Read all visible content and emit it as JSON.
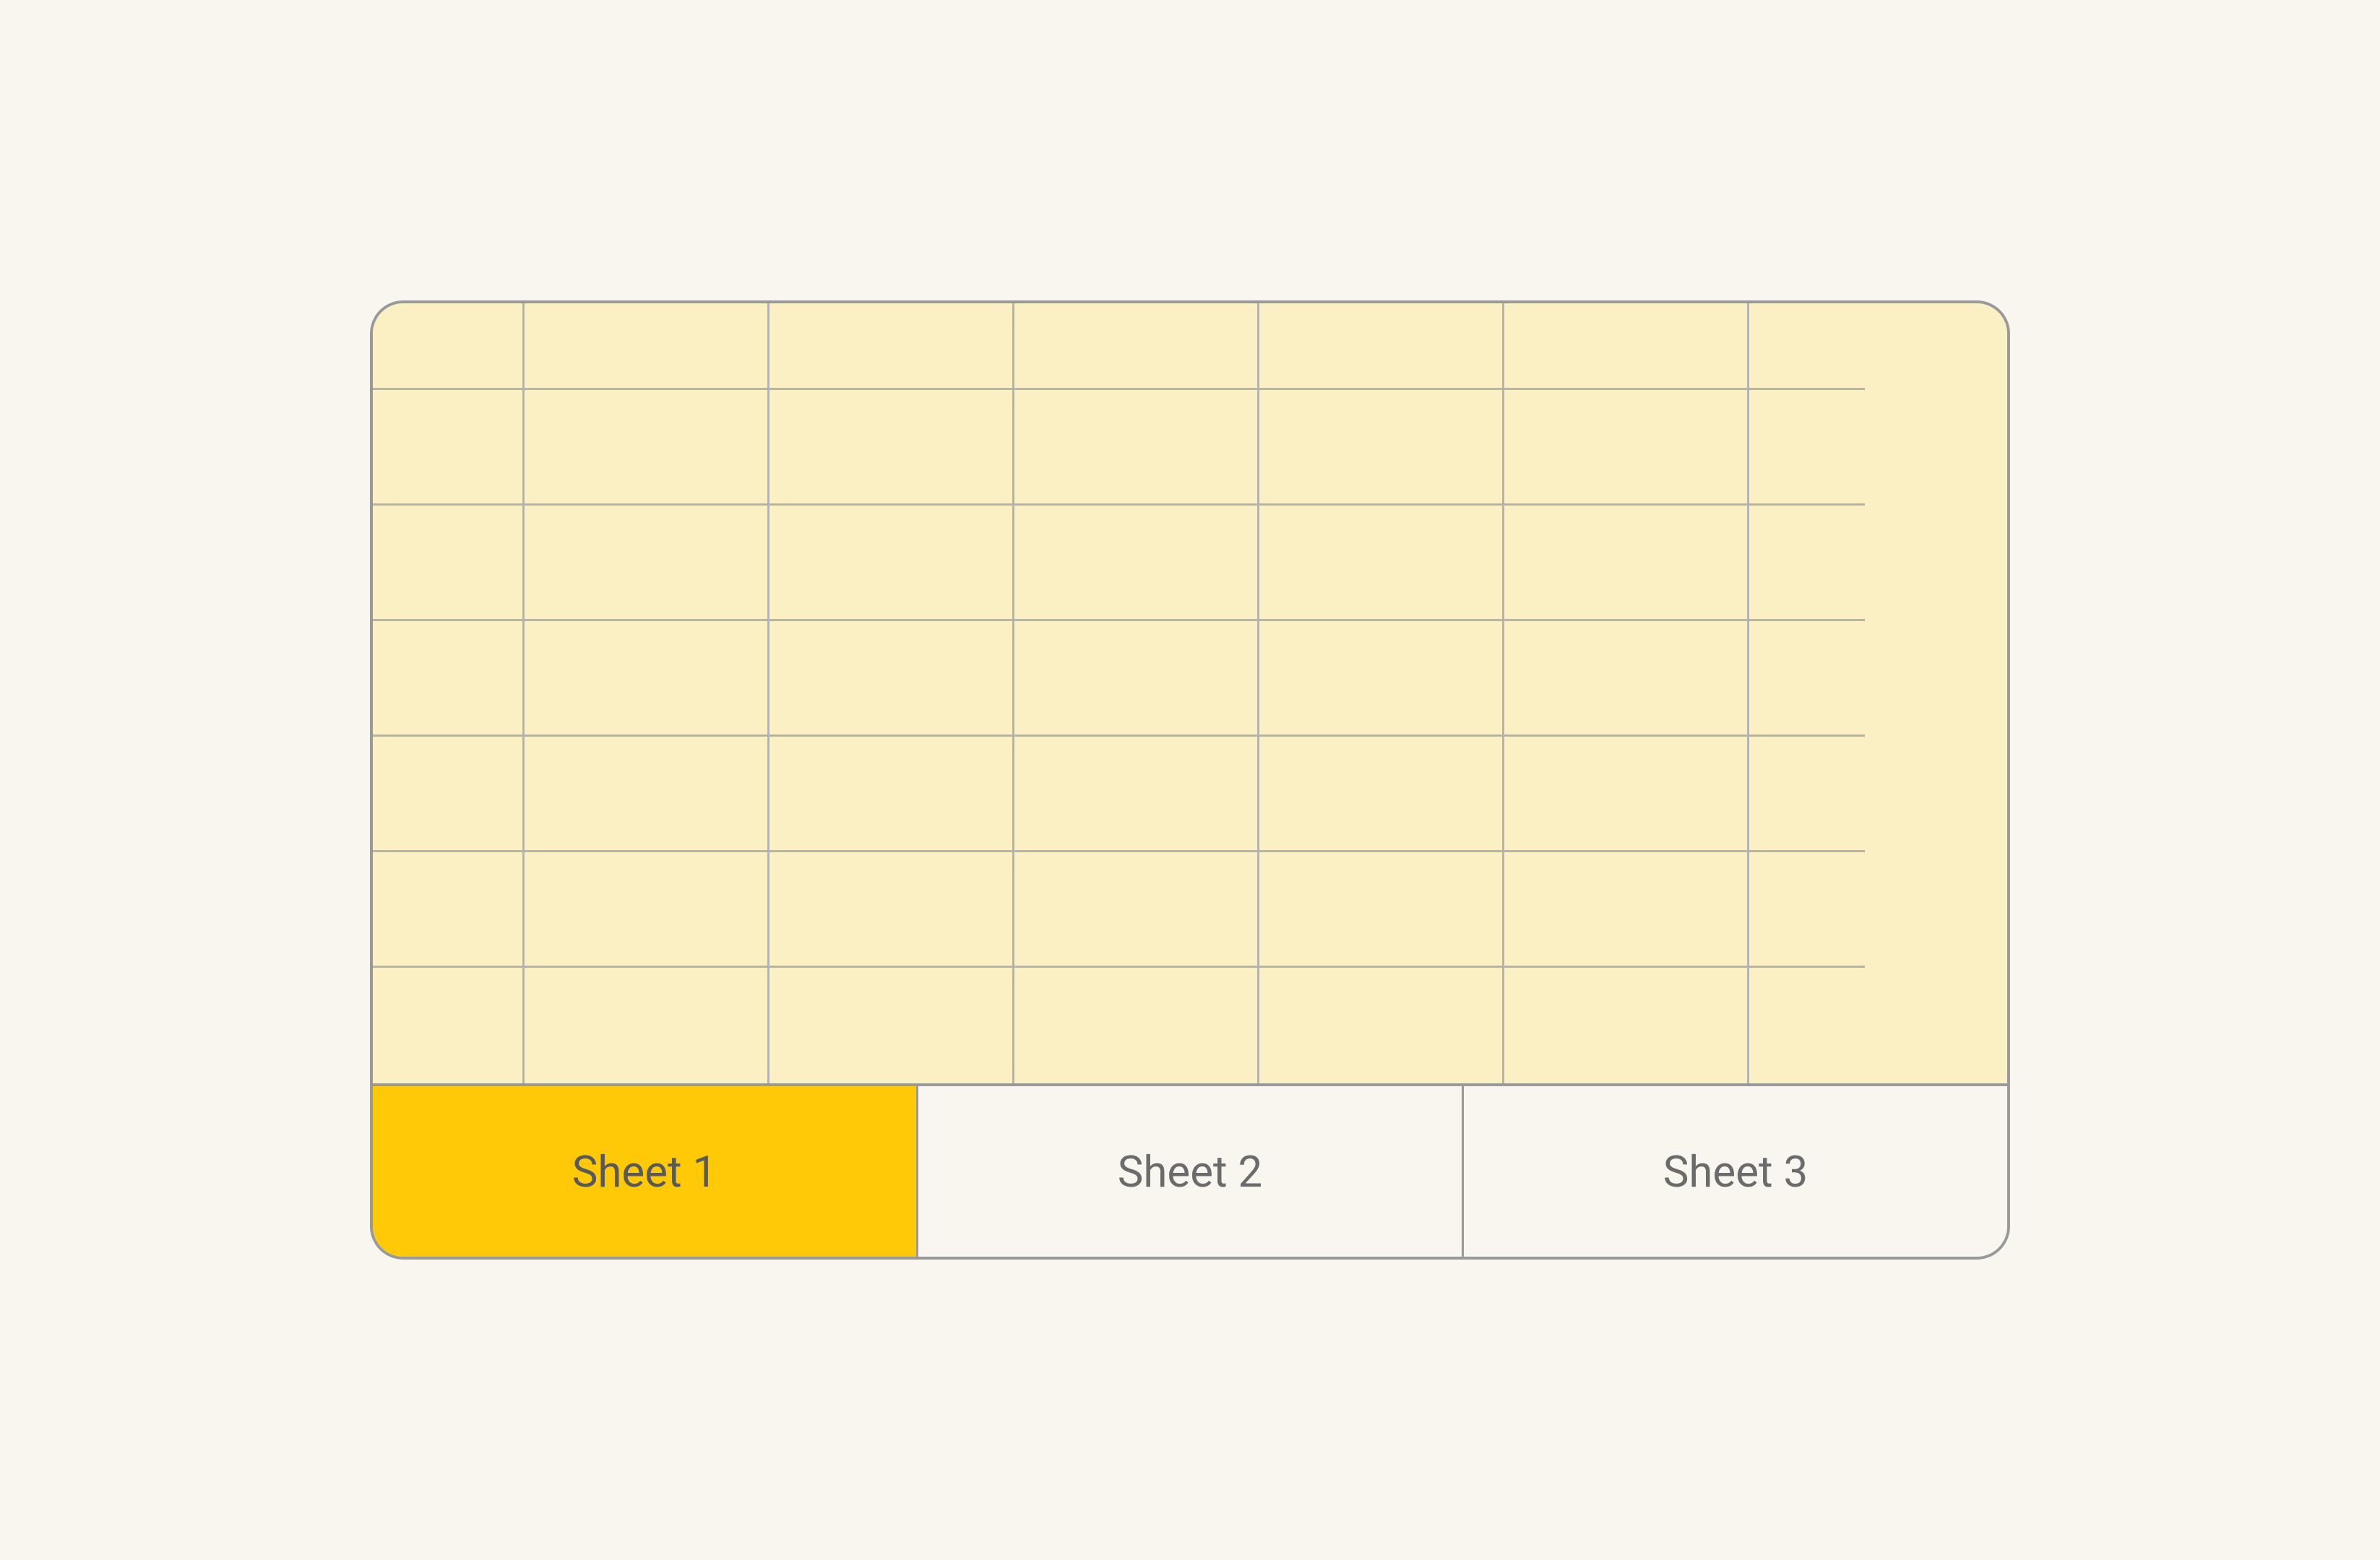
{
  "spreadsheet": {
    "grid": {
      "rows": 7,
      "cols": 7
    },
    "tabs": [
      {
        "label": "Sheet 1",
        "active": true
      },
      {
        "label": "Sheet 2",
        "active": false
      },
      {
        "label": "Sheet 3",
        "active": false
      }
    ]
  },
  "colors": {
    "background": "#f9f6ef",
    "grid_fill": "#fbf0c4",
    "border": "#999",
    "cell_border": "#b3b3b3",
    "tab_active": "#ffc907",
    "tab_text": "#6b6b6b"
  }
}
